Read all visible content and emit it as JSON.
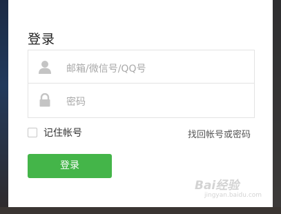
{
  "login": {
    "title": "登录",
    "username_placeholder": "邮箱/微信号/QQ号",
    "password_placeholder": "密码",
    "remember_label": "记住帐号",
    "forgot_link": "找回帐号或密码",
    "submit_label": "登录"
  },
  "icons": {
    "user": "user-icon",
    "lock": "lock-icon"
  },
  "colors": {
    "primary_button": "#44b549",
    "placeholder_text": "#a9a9a9"
  },
  "watermark": {
    "logo_text": "Bai经验",
    "url": "jingyan.baidu.com"
  }
}
